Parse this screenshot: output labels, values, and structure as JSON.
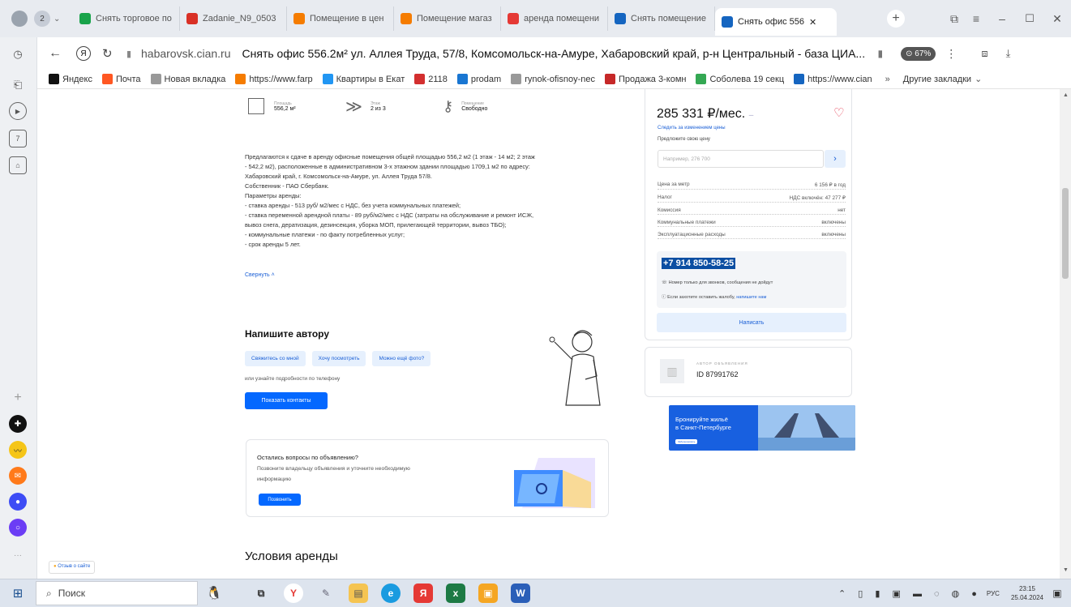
{
  "browser": {
    "tab_count": "2",
    "tabs": [
      {
        "title": "Снять торговое по",
        "color": "#18a34a"
      },
      {
        "title": "Zadanie_N9_0503",
        "color": "#d93025"
      },
      {
        "title": "Помещение в цен",
        "color": "#f57c00"
      },
      {
        "title": "Помещение магаз",
        "color": "#f57c00"
      },
      {
        "title": "аренда помещени",
        "color": "#e53935"
      },
      {
        "title": "Снять помещение",
        "color": "#1565c0"
      },
      {
        "title": "Снять офис 556",
        "color": "#1565c0"
      }
    ],
    "new_tab": "+",
    "domain": "habarovsk.cian.ru",
    "page_title": "Снять офис 556.2м² ул. Аллея Труда, 57/8, Комсомольск-на-Амуре, Хабаровский край, р-н Центральный - база ЦИА...",
    "zoom": "67%",
    "bookmarks": [
      {
        "label": "Яндекс",
        "color": "#111"
      },
      {
        "label": "Почта",
        "color": "#ff5722"
      },
      {
        "label": "Новая вкладка",
        "color": "#999"
      },
      {
        "label": "https://www.farp",
        "color": "#f57c00"
      },
      {
        "label": "Квартиры в Екат",
        "color": "#2196f3"
      },
      {
        "label": "2118",
        "color": "#d32f2f"
      },
      {
        "label": "prodam",
        "color": "#1976d2"
      },
      {
        "label": "rynok-ofisnoy-nec",
        "color": "#999"
      },
      {
        "label": "Продажа 3-комн",
        "color": "#c62828"
      },
      {
        "label": "Соболева 19 секц",
        "color": "#34a853"
      },
      {
        "label": "https://www.cian",
        "color": "#1565c0"
      }
    ],
    "more_bookmarks": "Другие закладки"
  },
  "features": [
    {
      "label": "Площадь",
      "value": "556,2 м²",
      "icon": "area-icon"
    },
    {
      "label": "Этаж",
      "value": "2 из 3",
      "icon": "floor-icon"
    },
    {
      "label": "Помещение",
      "value": "Свободно",
      "icon": "key-icon"
    }
  ],
  "description": [
    "Предлагаются к сдаче в аренду офисные помещения общей площадью 556,2 м2 (1 этаж - 14 м2; 2 этаж",
    "- 542,2 м2), расположенные в административном 3-х этажном здании площадью 1709,1 м2 по адресу:",
    "Хабаровский край, г. Комсомольск-на-Амуре, ул. Аллея Труда 57/8.",
    "Собственник - ПАО Сбербанк.",
    "Параметры аренды:",
    "- ставка аренды - 513 руб/ м2/мес с НДС, без учета коммунальных платежей;",
    "- ставка переменной арендной платы - 89 руб/м2/мес с НДС (затраты на обслуживание и ремонт ИСЖ,",
    "вывоз снега, дератизация, дезинсекция, уборка МОП, прилегающей территории, вывоз ТБО);",
    "- коммунальные платежи - по факту потребленных услуг;",
    "- срок аренды 5 лет."
  ],
  "collapse_link": "Свернуть",
  "write_author": {
    "title": "Напишите автору",
    "chips": [
      "Свяжитесь со мной",
      "Хочу посмотреть",
      "Можно ещё фото?"
    ],
    "hint": "или узнайте подробности по телефону",
    "button": "Показать контакты"
  },
  "questions": {
    "title": "Остались вопросы по объявлению?",
    "text1": "Позвоните владельцу объявления и уточните необходимую",
    "text2": "информацию",
    "button": "Позвонить"
  },
  "conditions_title": "Условия аренды",
  "price": {
    "value": "285 331 ₽/мес.",
    "watch": "Следить за изменением цены",
    "offer_label": "Предложите свою цену",
    "offer_placeholder": "Например, 276 700",
    "rows": [
      {
        "k": "Цена за метр",
        "v": "6 156 ₽ в год"
      },
      {
        "k": "Налог",
        "v": "НДС включён: 47 277 ₽"
      },
      {
        "k": "Комиссия",
        "v": "нет"
      },
      {
        "k": "Коммунальные платежи",
        "v": "включены"
      },
      {
        "k": "Эксплуатационные расходы",
        "v": "включены"
      }
    ],
    "phone": "+7 914 850-58-25",
    "phone_note": "Номер только для звонков, сообщения не дойдут",
    "complaint": "Если захотите оставить жалобу,",
    "complaint_link": "напишите нам",
    "write_button": "Написать"
  },
  "author": {
    "label": "АВТОР ОБЪЯВЛЕНИЯ",
    "id": "ID 87991762"
  },
  "promo": {
    "line1": "Бронируйте жильё",
    "line2": "в Санкт-Петербурге",
    "badge": "Забронировать"
  },
  "feedback": "Отзыв о сайте",
  "taskbar": {
    "search": "Поиск",
    "lang": "РУС",
    "time": "23:15",
    "date": "25.04.2024"
  }
}
